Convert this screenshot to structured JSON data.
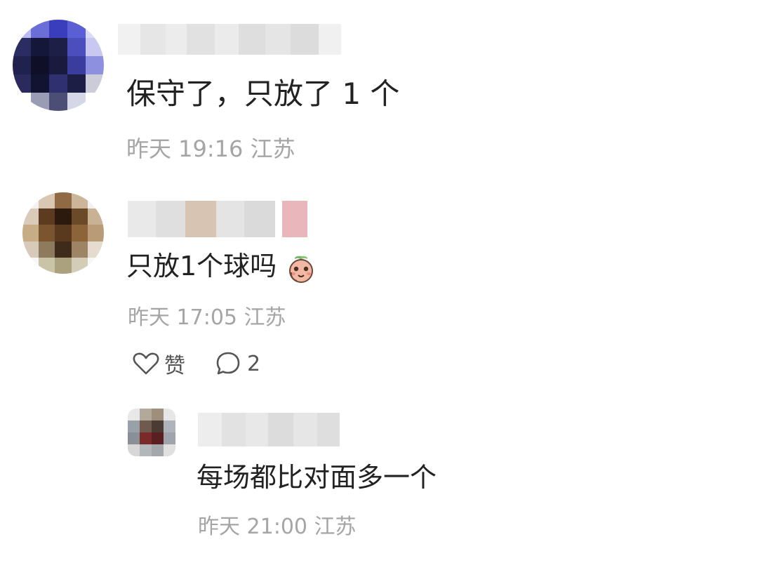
{
  "comments": [
    {
      "text": "保守了，只放了 1 个",
      "time": "昨天 19:16",
      "location": "江苏"
    },
    {
      "text": "只放1个球吗",
      "emoji": "peach-face-emoji",
      "time": "昨天 17:05",
      "location": "江苏",
      "like_label": "赞",
      "reply_count": "2"
    }
  ],
  "reply": {
    "text": "每场都比对面多一个",
    "time": "昨天 21:00",
    "location": "江苏"
  },
  "icons": {
    "like": "heart-outline-icon",
    "reply": "speech-bubble-icon"
  },
  "colors": {
    "text": "#222222",
    "meta": "#a5a5a5",
    "action": "#555555"
  }
}
